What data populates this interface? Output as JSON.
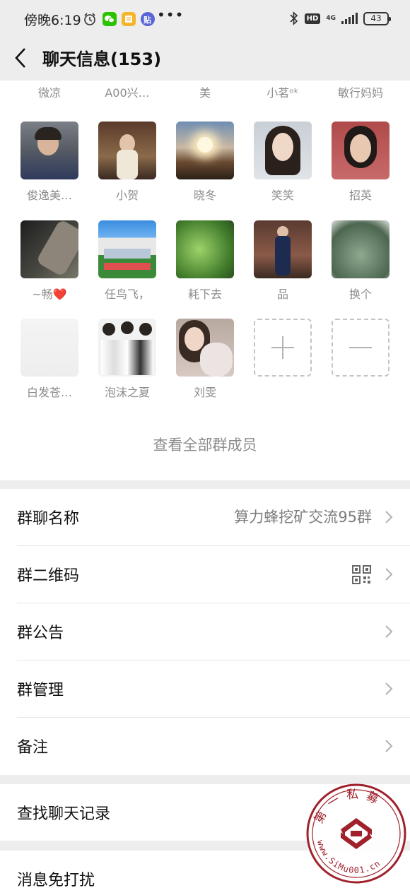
{
  "status_bar": {
    "time": "傍晚6:19",
    "dots": "•••",
    "network": "4G",
    "hd_badge": "HD",
    "battery": "43",
    "icons": [
      "alarm-clock-icon",
      "wechat-icon",
      "notes-app-icon",
      "tieba-app-icon",
      "bluetooth-icon"
    ],
    "colors": {
      "wechat": "#2dc100",
      "notes": "#f5b42a",
      "tieba": "#5964d6"
    }
  },
  "nav": {
    "title": "聊天信息(153)",
    "back_icon": "chevron-left-icon"
  },
  "members": {
    "top_partial_names": [
      "微凉",
      "A00兴…",
      "美",
      "小茗ᵒᵏ",
      "敏行妈妈"
    ],
    "rows": [
      [
        "俊逸美…",
        "小贺",
        "晓冬",
        "笑笑",
        "招英"
      ],
      [
        "~畅❤️",
        "任鸟飞，",
        "耗下去",
        "品",
        "换个"
      ],
      [
        "白发苍…",
        "泡沫之夏",
        "刘雯"
      ]
    ],
    "add_icon": "plus-icon",
    "remove_icon": "minus-icon",
    "view_all": "查看全部群成员"
  },
  "settings": {
    "group_name_label": "群聊名称",
    "group_name_value": "算力蜂挖矿交流95群",
    "qr_label": "群二维码",
    "qr_icon": "qr-code-icon",
    "notice_label": "群公告",
    "manage_label": "群管理",
    "remark_label": "备注",
    "search_label": "查找聊天记录",
    "mute_label": "消息免打扰"
  },
  "watermark": {
    "text": "第一私募",
    "url": "www.SiMu001.cn",
    "color": "#a0212b"
  }
}
